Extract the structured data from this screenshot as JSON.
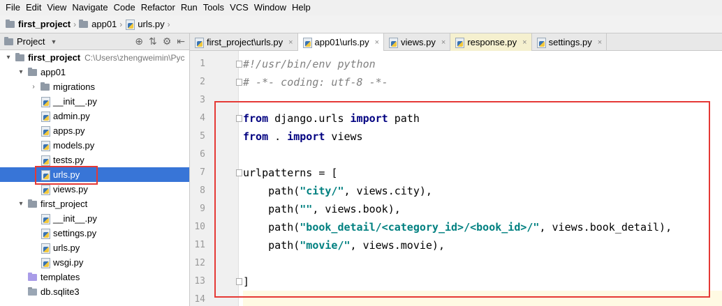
{
  "menu": [
    "File",
    "Edit",
    "View",
    "Navigate",
    "Code",
    "Refactor",
    "Run",
    "Tools",
    "VCS",
    "Window",
    "Help"
  ],
  "breadcrumb": {
    "project": "first_project",
    "folder": "app01",
    "file": "urls.py"
  },
  "project_pane": {
    "view_label": "Project"
  },
  "tree": [
    {
      "label": "first_project",
      "path": "C:\\Users\\zhengweimin\\Pyc",
      "level": 0,
      "type": "folder",
      "expanded": true,
      "bold": true
    },
    {
      "label": "app01",
      "level": 1,
      "type": "folder",
      "expanded": true
    },
    {
      "label": "migrations",
      "level": 2,
      "type": "folder",
      "expanded": false
    },
    {
      "label": "__init__.py",
      "level": 2,
      "type": "py"
    },
    {
      "label": "admin.py",
      "level": 2,
      "type": "py"
    },
    {
      "label": "apps.py",
      "level": 2,
      "type": "py"
    },
    {
      "label": "models.py",
      "level": 2,
      "type": "py"
    },
    {
      "label": "tests.py",
      "level": 2,
      "type": "py"
    },
    {
      "label": "urls.py",
      "level": 2,
      "type": "py",
      "selected": true
    },
    {
      "label": "views.py",
      "level": 2,
      "type": "py"
    },
    {
      "label": "first_project",
      "level": 1,
      "type": "folder",
      "expanded": true
    },
    {
      "label": "__init__.py",
      "level": 2,
      "type": "py"
    },
    {
      "label": "settings.py",
      "level": 2,
      "type": "py"
    },
    {
      "label": "urls.py",
      "level": 2,
      "type": "py"
    },
    {
      "label": "wsgi.py",
      "level": 2,
      "type": "py"
    },
    {
      "label": "templates",
      "level": 1,
      "type": "folder-purple"
    },
    {
      "label": "db.sqlite3",
      "level": 1,
      "type": "db"
    }
  ],
  "tabs": [
    {
      "label": "first_project\\urls.py",
      "style": "normal"
    },
    {
      "label": "app01\\urls.py",
      "style": "active"
    },
    {
      "label": "views.py",
      "style": "normal"
    },
    {
      "label": "response.py",
      "style": "yellow"
    },
    {
      "label": "settings.py",
      "style": "normal"
    }
  ],
  "code_lines": [
    {
      "n": "1",
      "text": "#!/usr/bin/env python"
    },
    {
      "n": "2",
      "text": "# -*- coding: utf-8 -*-"
    },
    {
      "n": "3",
      "text": ""
    },
    {
      "n": "4",
      "text": "from django.urls import path"
    },
    {
      "n": "5",
      "text": "from . import views"
    },
    {
      "n": "6",
      "text": ""
    },
    {
      "n": "7",
      "text": "urlpatterns = ["
    },
    {
      "n": "8",
      "text": "    path(\"city/\", views.city),"
    },
    {
      "n": "9",
      "text": "    path(\"\", views.book),"
    },
    {
      "n": "10",
      "text": "    path(\"book_detail/<category_id>/<book_id>/\", views.book_detail),"
    },
    {
      "n": "11",
      "text": "    path(\"movie/\", views.movie),"
    },
    {
      "n": "12",
      "text": ""
    },
    {
      "n": "13",
      "text": "]"
    },
    {
      "n": "14",
      "text": ""
    }
  ],
  "colors": {
    "selection": "#3875d7",
    "highlight_box": "#e53935",
    "keyword": "#000080",
    "string": "#008080",
    "comment": "#808080"
  }
}
